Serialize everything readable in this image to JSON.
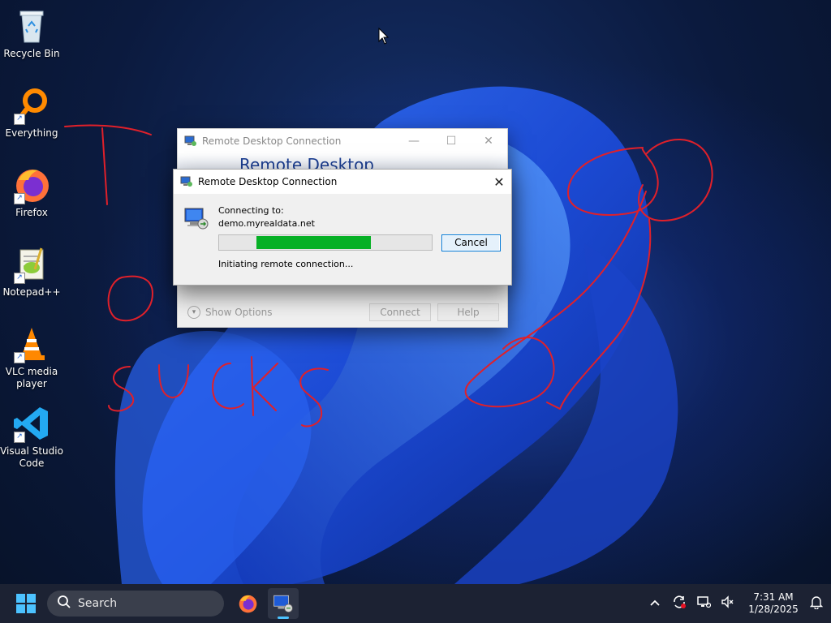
{
  "desktop": {
    "icons": [
      {
        "label": "Recycle Bin"
      },
      {
        "label": "Everything"
      },
      {
        "label": "Firefox"
      },
      {
        "label": "Notepad++"
      },
      {
        "label": "VLC media player"
      },
      {
        "label": "Visual Studio Code"
      }
    ]
  },
  "back_window": {
    "title": "Remote Desktop Connection",
    "banner": "Remote Desktop",
    "show_options": "Show Options",
    "connect": "Connect",
    "help": "Help"
  },
  "dialog": {
    "title": "Remote Desktop Connection",
    "connecting_to_label": "Connecting to:",
    "host": "demo.myrealdata.net",
    "progress": 0.66,
    "status": "Initiating remote connection...",
    "cancel": "Cancel"
  },
  "taskbar": {
    "search_label": "Search",
    "time": "7:31 AM",
    "date": "1/28/2025",
    "accent_color": "#4cc2ff"
  }
}
